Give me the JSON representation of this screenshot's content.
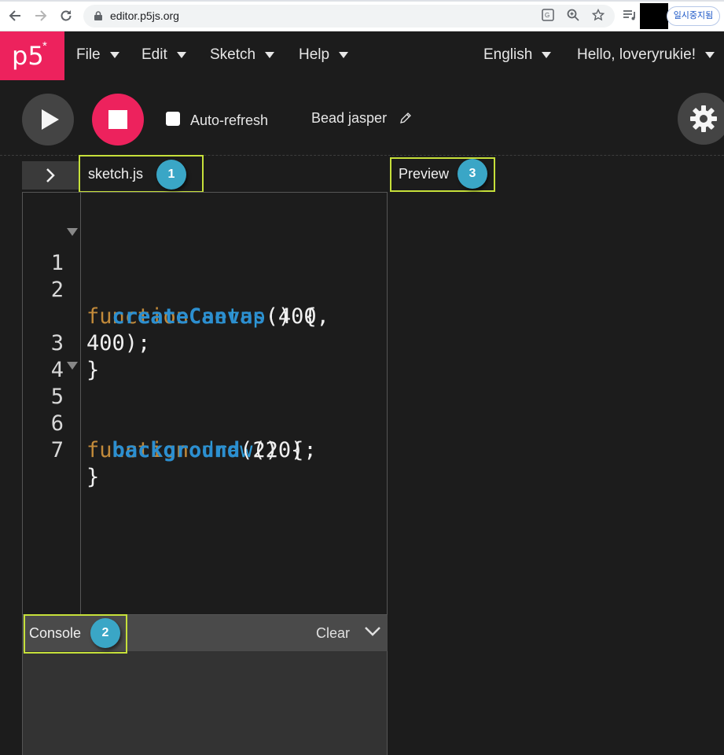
{
  "browser": {
    "url": "editor.p5js.org",
    "pause_button_label": "일시중지됨"
  },
  "nav": {
    "logo": "p5",
    "logo_star": "*",
    "menus": [
      "File",
      "Edit",
      "Sketch",
      "Help"
    ],
    "language": "English",
    "greeting": "Hello, loveryrukie!"
  },
  "toolbar": {
    "auto_refresh_label": "Auto-refresh",
    "auto_refresh_checked": false,
    "project_name": "Bead jasper"
  },
  "editor": {
    "tab_name": "sketch.js",
    "preview_label": "Preview",
    "lines": [
      {
        "num": "1",
        "fold": true
      },
      {
        "num": "2",
        "fold": false
      },
      {
        "num": "",
        "fold": false
      },
      {
        "num": "3",
        "fold": false
      },
      {
        "num": "4",
        "fold": false
      },
      {
        "num": "5",
        "fold": true
      },
      {
        "num": "6",
        "fold": false
      },
      {
        "num": "7",
        "fold": false
      }
    ],
    "code": {
      "l1_kw": "function",
      "l1_fn": "setup",
      "l1_rest": "() {",
      "l2_fn": "createCanvas",
      "l2_rest": "(400,",
      "l2b": "400);",
      "l3": "}",
      "l5_kw": "function",
      "l5_fn": "draw",
      "l5_rest": "() {",
      "l6_fn": "background",
      "l6_rest": "(220);",
      "l7": "}"
    }
  },
  "console": {
    "label": "Console",
    "clear_label": "Clear"
  },
  "annotations": {
    "badge_1": "1",
    "badge_2": "2",
    "badge_3": "3"
  },
  "colors": {
    "brand_pink": "#ed225d",
    "highlight": "#c6e03a",
    "badge": "#3aa6c6",
    "keyword": "#c28a3a",
    "function": "#2f9bd8"
  }
}
